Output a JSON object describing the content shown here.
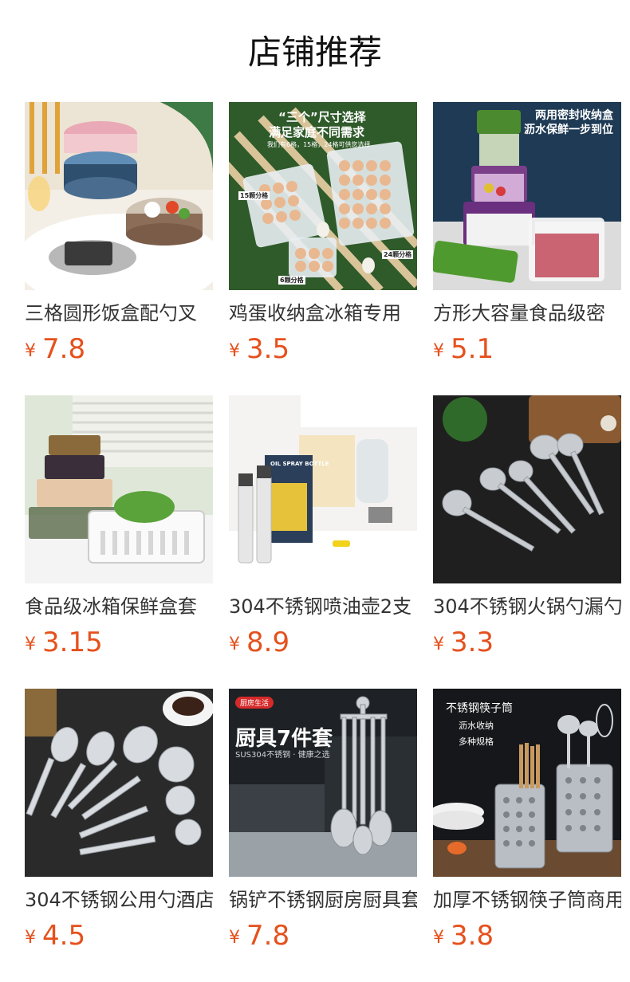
{
  "page": {
    "title": "店铺推荐"
  },
  "colors": {
    "price": "#e5511d",
    "name": "#333333",
    "title": "#111111"
  },
  "products": [
    {
      "name": "三格圆形饭盒配勺叉",
      "currency": "¥",
      "price": "7.8",
      "image_icon": "lunch-box-image",
      "image_text": []
    },
    {
      "name": "鸡蛋收纳盒冰箱专用",
      "currency": "¥",
      "price": "3.5",
      "image_icon": "egg-storage-box-image",
      "image_text": [
        "“三个”尺寸选择",
        "满足家庭不同需求",
        "我们有6格，15格，24格可供您选择",
        "15颗分格",
        "24颗分格",
        "6颗分格"
      ]
    },
    {
      "name": "方形大容量食品级密",
      "currency": "¥",
      "price": "5.1",
      "image_icon": "food-container-image",
      "image_text": [
        "两用密封收纳盒",
        "沥水保鲜一步到位"
      ]
    },
    {
      "name": "食品级冰箱保鲜盒套",
      "currency": "¥",
      "price": "3.15",
      "image_icon": "fridge-box-set-image",
      "image_text": []
    },
    {
      "name": "304不锈钢喷油壶2支",
      "currency": "¥",
      "price": "8.9",
      "image_icon": "oil-spray-bottle-image",
      "image_text": [
        "OIL SPRAY BOTTLE"
      ]
    },
    {
      "name": "304不锈钢火锅勺漏勺",
      "currency": "¥",
      "price": "3.3",
      "image_icon": "hotpot-ladle-image",
      "image_text": []
    },
    {
      "name": "304不锈钢公用勺酒店",
      "currency": "¥",
      "price": "4.5",
      "image_icon": "serving-spoon-image",
      "image_text": []
    },
    {
      "name": "锅铲不锈钢厨房厨具套",
      "currency": "¥",
      "price": "7.8",
      "image_icon": "kitchen-utensil-set-image",
      "image_text": [
        "厨房生活",
        "厨具7件套",
        "SUS304不锈钢 · 健康之选"
      ]
    },
    {
      "name": "加厚不锈钢筷子筒商用",
      "currency": "¥",
      "price": "3.8",
      "image_icon": "chopstick-holder-image",
      "image_text": [
        "不锈钢筷子筒",
        "沥水收纳",
        "多种规格"
      ]
    }
  ]
}
